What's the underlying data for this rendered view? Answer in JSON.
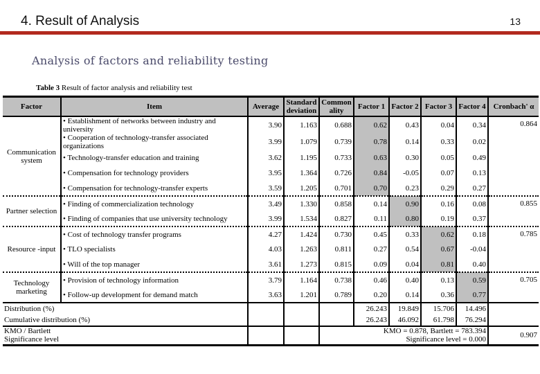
{
  "header": {
    "title": "4. Result of Analysis",
    "page_number": "13",
    "accent_color": "#b22a1e"
  },
  "subtitle": "Analysis of factors and reliability testing",
  "caption": {
    "label": "Table 3",
    "text": " Result of factor analysis and reliability test"
  },
  "table": {
    "columns": [
      "Factor",
      "Item",
      "Average",
      "Standard deviation",
      "Common ality",
      "Factor 1",
      "Factor 2",
      "Factor 3",
      "Factor 4",
      "Cronbach' α"
    ],
    "groups": [
      {
        "factor": "Communication system",
        "cronbach": "0.864",
        "items": [
          {
            "item": "• Establishment of networks between industry and university",
            "avg": "3.90",
            "sd": "1.163",
            "comm": "0.688",
            "f1": "0.62",
            "f2": "0.43",
            "f3": "0.04",
            "f4": "0.34"
          },
          {
            "item": "• Cooperation of technology-transfer associated organizations",
            "avg": "3.99",
            "sd": "1.079",
            "comm": "0.739",
            "f1": "0.78",
            "f2": "0.14",
            "f3": "0.33",
            "f4": "0.02"
          },
          {
            "item": "• Technology-transfer education and training",
            "avg": "3.62",
            "sd": "1.195",
            "comm": "0.733",
            "f1": "0.63",
            "f2": "0.30",
            "f3": "0.05",
            "f4": "0.49"
          },
          {
            "item": "• Compensation for technology providers",
            "avg": "3.95",
            "sd": "1.364",
            "comm": "0.726",
            "f1": "0.84",
            "f2": "-0.05",
            "f3": "0.07",
            "f4": "0.13"
          },
          {
            "item": "• Compensation for technology-transfer experts",
            "avg": "3.59",
            "sd": "1.205",
            "comm": "0.701",
            "f1": "0.70",
            "f2": "0.23",
            "f3": "0.29",
            "f4": "0.27"
          }
        ]
      },
      {
        "factor": "Partner selection",
        "cronbach": "0.855",
        "items": [
          {
            "item": "• Finding of commercialization technology",
            "avg": "3.49",
            "sd": "1.330",
            "comm": "0.858",
            "f1": "0.14",
            "f2": "0.90",
            "f3": "0.16",
            "f4": "0.08"
          },
          {
            "item": "• Finding of companies that use university technology",
            "avg": "3.99",
            "sd": "1.534",
            "comm": "0.827",
            "f1": "0.11",
            "f2": "0.80",
            "f3": "0.19",
            "f4": "0.37"
          }
        ]
      },
      {
        "factor": "Resource -input",
        "cronbach": "0.785",
        "items": [
          {
            "item": "• Cost of technology transfer programs",
            "avg": "4.27",
            "sd": "1.424",
            "comm": "0.730",
            "f1": "0.45",
            "f2": "0.33",
            "f3": "0.62",
            "f4": "0.18"
          },
          {
            "item": "• TLO specialists",
            "avg": "4.03",
            "sd": "1.263",
            "comm": "0.811",
            "f1": "0.27",
            "f2": "0.54",
            "f3": "0.67",
            "f4": "-0.04"
          },
          {
            "item": "• Will of the top manager",
            "avg": "3.61",
            "sd": "1.273",
            "comm": "0.815",
            "f1": "0.09",
            "f2": "0.04",
            "f3": "0.81",
            "f4": "0.40"
          }
        ]
      },
      {
        "factor": "Technology marketing",
        "cronbach": "0.705",
        "items": [
          {
            "item": "• Provision of technology information",
            "avg": "3.79",
            "sd": "1.164",
            "comm": "0.738",
            "f1": "0.46",
            "f2": "0.40",
            "f3": "0.13",
            "f4": "0.59"
          },
          {
            "item": "• Follow-up development for demand match",
            "avg": "3.63",
            "sd": "1.201",
            "comm": "0.789",
            "f1": "0.20",
            "f2": "0.14",
            "f3": "0.36",
            "f4": "0.77"
          }
        ]
      }
    ],
    "footer": {
      "distribution_label": "Distribution (%)",
      "distribution": [
        "26.243",
        "19.849",
        "15.706",
        "14.496"
      ],
      "cumulative_label": "Cumulative distribution (%)",
      "cumulative": [
        "26.243",
        "46.092",
        "61.798",
        "76.294"
      ],
      "kmo_label_1": "KMO / Bartlett",
      "kmo_label_2": "Significance level",
      "kmo_text_1": "KMO = 0.878, Bartlett = 783.394",
      "kmo_text_2": "Significance level = 0.000",
      "total_cronbach": "0.907"
    }
  }
}
